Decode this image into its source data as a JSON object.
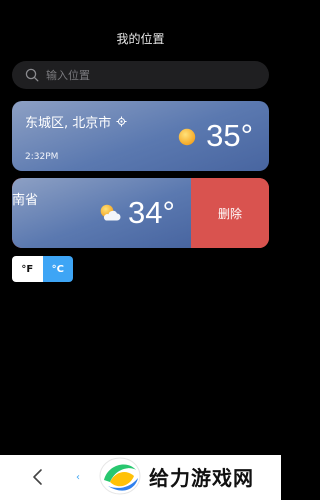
{
  "header": {
    "title": "我的位置"
  },
  "search": {
    "placeholder": "输入位置"
  },
  "locations": [
    {
      "city": "东城区, 北京市",
      "time": "2:32PM",
      "temperature": "35°",
      "weather_icon": "sunny-icon"
    },
    {
      "city": "南省",
      "temperature": "34°",
      "weather_icon": "partly-cloudy-icon",
      "delete_label": "删除"
    }
  ],
  "units": {
    "fahrenheit": "°F",
    "celsius": "°C",
    "selected": "celsius"
  },
  "bottom_bar": {
    "partial_text": "‹"
  },
  "watermark": {
    "text": "给力游戏网"
  },
  "colors": {
    "background": "#000000",
    "card_gradient": "#5b79b0",
    "delete": "#d9534f",
    "accent": "#3ea5f5"
  }
}
